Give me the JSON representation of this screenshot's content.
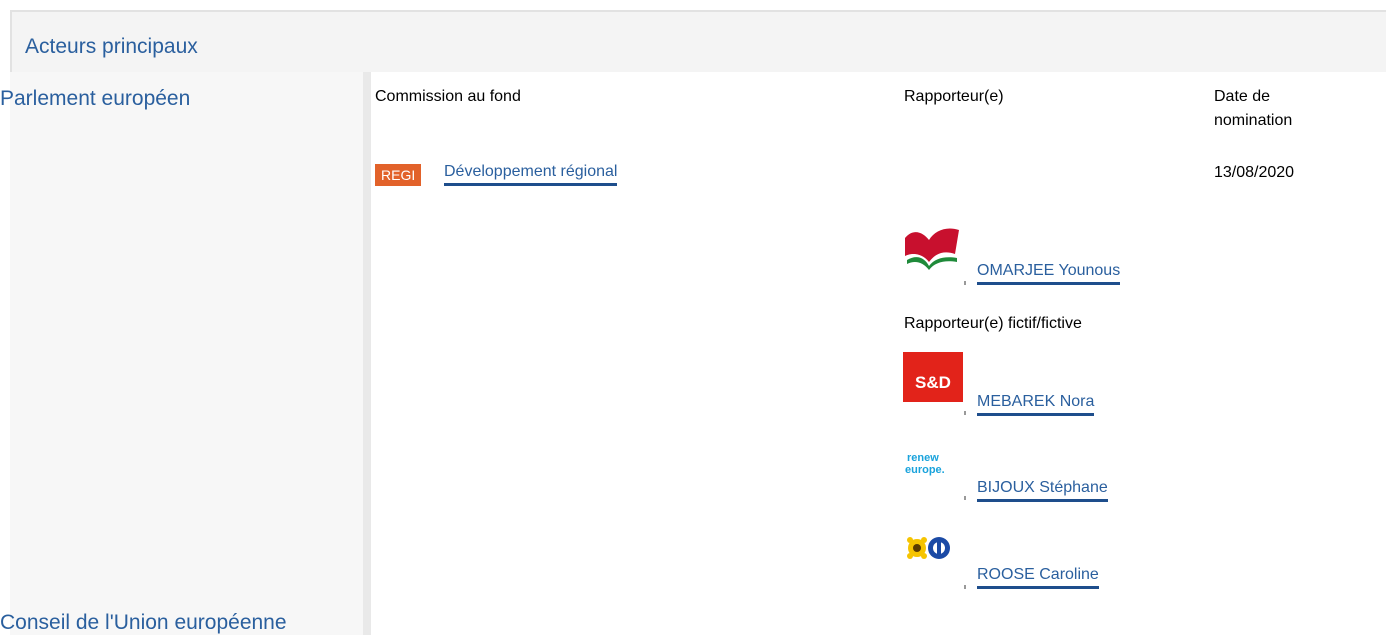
{
  "header": {
    "title": "Acteurs principaux"
  },
  "institutions": {
    "parliament": "Parlement européen",
    "council": "Conseil de l'Union européenne"
  },
  "columns": {
    "committee": "Commission au fond",
    "rapporteur": "Rapporteur(e)",
    "date": "Date de nomination"
  },
  "committee": {
    "code": "REGI",
    "name": "Développement régional",
    "date": "13/08/2020",
    "badge_color": "#e2622a"
  },
  "rapporteur": {
    "name": "OMARJEE Younous",
    "group_logo": "gue-ngl-flag-logo"
  },
  "shadow": {
    "label": "Rapporteur(e) fictif/fictive",
    "people": [
      {
        "name": "MEBAREK Nora",
        "group_logo": "s-and-d-logo",
        "logo_text": "S&D"
      },
      {
        "name": "BIJOUX Stéphane",
        "group_logo": "renew-europe-logo",
        "logo_text": "renew europe."
      },
      {
        "name": "ROOSE Caroline",
        "group_logo": "greens-efa-logo"
      }
    ]
  },
  "colors": {
    "link": "#2a5f9e",
    "link_underline": "#1e4e8c",
    "header_bg": "#f4f4f4"
  }
}
